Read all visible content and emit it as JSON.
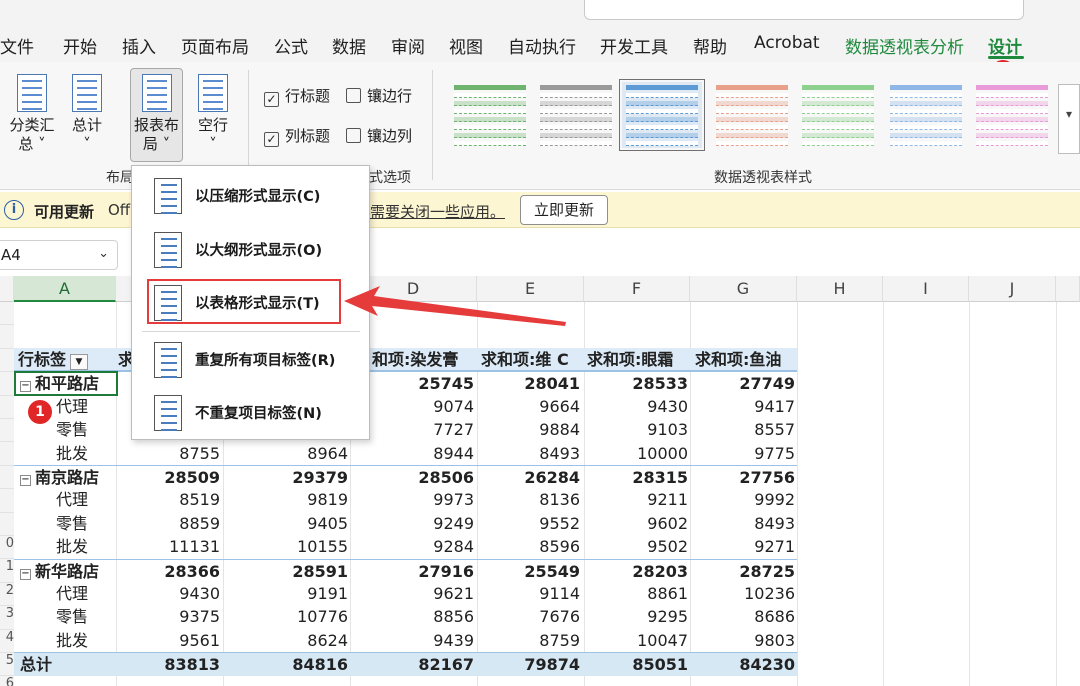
{
  "menu": {
    "items": [
      "文件",
      "开始",
      "插入",
      "页面布局",
      "公式",
      "数据",
      "审阅",
      "视图",
      "自动执行",
      "开发工具",
      "帮助",
      "Acrobat",
      "数据透视表分析",
      "设计"
    ],
    "active": "设计"
  },
  "ribbon": {
    "layout_buttons": [
      {
        "label": "分类汇\n总 ˅"
      },
      {
        "label": "总计\n˅"
      },
      {
        "label": "报表布\n局 ˅"
      },
      {
        "label": "空行\n˅"
      }
    ],
    "layout_group_label": "布局",
    "options": {
      "row_headers": "行标题",
      "col_headers": "列标题",
      "banded_rows": "镶边行",
      "banded_cols": "镶边列",
      "group_label": "数据透视表样式选项",
      "group_label_visible": "式选项"
    },
    "styles_group_label": "数据透视表样式",
    "style_colors": [
      "#6fb36f",
      "#9a9a9a",
      "#5d9bd6",
      "#e8a08a",
      "#8ed08e",
      "#8fb8e8",
      "#e99ad8"
    ]
  },
  "dropdown": {
    "items": [
      "以压缩形式显示(C)",
      "以大纲形式显示(O)",
      "以表格形式显示(T)",
      "重复所有项目标签(R)",
      "不重复项目标签(N)"
    ]
  },
  "infobar": {
    "title": "可用更新",
    "message": "Off",
    "message2": "需要关闭一些应用。",
    "button": "立即更新"
  },
  "namebox": {
    "value": "A4"
  },
  "columns": [
    "A",
    "B",
    "C",
    "D",
    "E",
    "F",
    "G",
    "H",
    "I",
    "J"
  ],
  "row_numbers": [
    "",
    "",
    "",
    "",
    "",
    "",
    "",
    "",
    "",
    "",
    "0",
    "1",
    "2",
    "3",
    "4",
    "5",
    "6"
  ],
  "pivot": {
    "row_label_header": "行标签",
    "headers": [
      "求",
      "",
      "和项:染发膏",
      "求和项:维 C",
      "求和项:眼霜",
      "求和项:鱼油"
    ],
    "rows": [
      {
        "label": "和平路店",
        "kind": "group",
        "values": [
          "",
          "",
          "25745",
          "28041",
          "28533",
          "27749"
        ]
      },
      {
        "label": "代理",
        "kind": "item",
        "values": [
          "",
          "",
          "9074",
          "9664",
          "9430",
          "9417"
        ]
      },
      {
        "label": "零售",
        "kind": "item",
        "values": [
          "",
          "",
          "7727",
          "9884",
          "9103",
          "8557"
        ]
      },
      {
        "label": "批发",
        "kind": "item",
        "values": [
          "8755",
          "8964",
          "8944",
          "8493",
          "10000",
          "9775"
        ]
      },
      {
        "label": "南京路店",
        "kind": "group",
        "values": [
          "28509",
          "29379",
          "28506",
          "26284",
          "28315",
          "27756"
        ]
      },
      {
        "label": "代理",
        "kind": "item",
        "values": [
          "8519",
          "9819",
          "9973",
          "8136",
          "9211",
          "9992"
        ]
      },
      {
        "label": "零售",
        "kind": "item",
        "values": [
          "8859",
          "9405",
          "9249",
          "9552",
          "9602",
          "8493"
        ]
      },
      {
        "label": "批发",
        "kind": "item",
        "values": [
          "11131",
          "10155",
          "9284",
          "8596",
          "9502",
          "9271"
        ]
      },
      {
        "label": "新华路店",
        "kind": "group",
        "values": [
          "28366",
          "28591",
          "27916",
          "25549",
          "28203",
          "28725"
        ]
      },
      {
        "label": "代理",
        "kind": "item",
        "values": [
          "9430",
          "9191",
          "9621",
          "9114",
          "8861",
          "10236"
        ]
      },
      {
        "label": "零售",
        "kind": "item",
        "values": [
          "9375",
          "10776",
          "8856",
          "7676",
          "9295",
          "8686"
        ]
      },
      {
        "label": "批发",
        "kind": "item",
        "values": [
          "9561",
          "8624",
          "9439",
          "8759",
          "10047",
          "9803"
        ]
      },
      {
        "label": "总计",
        "kind": "total",
        "values": [
          "83813",
          "84816",
          "82167",
          "79874",
          "85051",
          "84230"
        ]
      }
    ]
  },
  "badges": {
    "one": "1",
    "two": "2"
  },
  "colors": {
    "accent": "#1f8a3d",
    "highlight": "#e53b3b",
    "pivot_header": "#dcebf7"
  }
}
